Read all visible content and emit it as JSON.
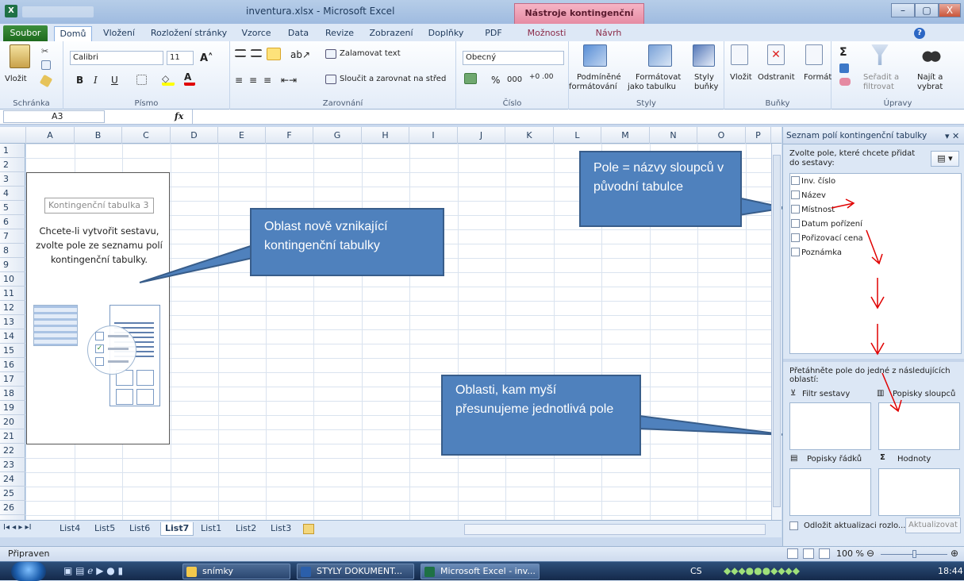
{
  "window": {
    "title": "inventura.xlsx - Microsoft Excel",
    "context_tab_group": "Nástroje kontingenční tabulky",
    "buttons": [
      "–",
      "▢",
      "X"
    ]
  },
  "ribbon_tabs": [
    "Soubor",
    "Domů",
    "Vložení",
    "Rozložení stránky",
    "Vzorce",
    "Data",
    "Revize",
    "Zobrazení",
    "Doplňky",
    "PDF",
    "Možnosti",
    "Návrh"
  ],
  "ribbon": {
    "clipboard": {
      "paste": "Vložit",
      "label": "Schránka"
    },
    "font": {
      "name": "Calibri",
      "size": "11",
      "bold": "B",
      "italic": "I",
      "underline": "U",
      "label": "Písmo"
    },
    "alignment": {
      "wrap": "Zalamovat text",
      "merge": "Sloučit a zarovnat na střed",
      "label": "Zarovnání"
    },
    "number": {
      "format": "Obecný",
      "percent": "%",
      "thousands": "000",
      "label": "Číslo"
    },
    "styles": {
      "conditional1": "Podmíněné",
      "conditional2": "formátování",
      "astable1": "Formátovat",
      "astable2": "jako tabulku",
      "cellstyles1": "Styly",
      "cellstyles2": "buňky",
      "label": "Styly"
    },
    "cells": {
      "insert": "Vložit",
      "delete": "Odstranit",
      "format": "Formát",
      "label": "Buňky"
    },
    "editing": {
      "sum": "Σ",
      "sort1": "Seřadit a",
      "sort2": "filtrovat",
      "find1": "Najít a",
      "find2": "vybrat",
      "label": "Úpravy"
    }
  },
  "formula_bar": {
    "name_box": "A3",
    "fx": "fx",
    "value": ""
  },
  "columns": [
    "A",
    "B",
    "C",
    "D",
    "E",
    "F",
    "G",
    "H",
    "I",
    "J",
    "K",
    "L",
    "M",
    "N",
    "O",
    "P"
  ],
  "rows": [
    "1",
    "2",
    "3",
    "4",
    "5",
    "6",
    "7",
    "8",
    "9",
    "10",
    "11",
    "12",
    "13",
    "14",
    "15",
    "16",
    "17",
    "18",
    "19",
    "20",
    "21",
    "22",
    "23",
    "24",
    "25",
    "26"
  ],
  "pivot_placeholder": {
    "caption": "Kontingenční tabulka 3",
    "message": "Chcete-li vytvořit sestavu, zvolte pole ze seznamu polí kontingenční tabulky."
  },
  "callouts": {
    "pivot_area": "Oblast nově vznikající kontingenční tabulky",
    "fields": "Pole = názvy sloupců v původní tabulce",
    "areas": "Oblasti, kam myší přesunujeme jednotlivá pole"
  },
  "field_list": {
    "title": "Seznam polí kontingenční tabulky",
    "choose": "Zvolte pole, které chcete přidat do sestavy:",
    "fields": [
      "Inv. číslo",
      "Název",
      "Místnost",
      "Datum pořízení",
      "Pořizovací cena",
      "Poznámka"
    ],
    "drag_hint": "Přetáhněte pole do jedné z následujících oblastí:",
    "areas": [
      "Filtr sestavy",
      "Popisky sloupců",
      "Popisky řádků",
      "Hodnoty"
    ],
    "defer": "Odložit aktualizaci rozlo...",
    "update": "Aktualizovat"
  },
  "sheet_tabs": [
    "List4",
    "List5",
    "List6",
    "List7",
    "List1",
    "List2",
    "List3"
  ],
  "active_sheet": "List7",
  "status": {
    "ready": "Připraven",
    "zoom": "100 %"
  },
  "taskbar": {
    "items": [
      "snímky",
      "STYLY DOKUMENT...",
      "Microsoft Excel - inv..."
    ],
    "lang": "CS",
    "time": "18:44"
  },
  "colors": {
    "callout": "#4f81bd",
    "arrow": "#e00000",
    "excel_green": "#1e6a1e"
  }
}
